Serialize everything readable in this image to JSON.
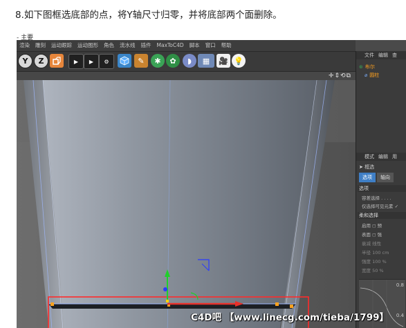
{
  "instruction": "8.如下图框选底部的点，将Y轴尺寸归零，并将底部两个面删除。",
  "caption": "- 主要",
  "menu": [
    "渲染",
    "雕刻",
    "运动跟踪",
    "运动图形",
    "角色",
    "流水线",
    "插件",
    "MaxToC4D",
    "脚本",
    "窗口",
    "帮助"
  ],
  "toolbar": {
    "y_lock": "Y",
    "z_lock": "Z",
    "world_icon": "coordinate-system-icon",
    "render_icons": [
      "render-view-icon",
      "render-picture-viewer-icon",
      "render-settings-icon"
    ],
    "object_icons": [
      "cube-icon",
      "pen-spline-icon",
      "subdivision-icon",
      "array-icon",
      "deformer-icon",
      "floor-icon",
      "camera-icon",
      "light-icon"
    ]
  },
  "viewport": {
    "nav_icons": "✛⇕⟲⧉",
    "selection_color": "#ff3333",
    "axis_y_color": "#1fd02a",
    "axis_x_color": "#e8302a",
    "axis_z_color": "#2a3bff",
    "point_color": "#ffa21e"
  },
  "right_panel": {
    "obj_tabs": [
      "文件",
      "编辑",
      "查"
    ],
    "objects": [
      {
        "name": "布尔",
        "icon": "boolean-icon"
      },
      {
        "name": "圆柱",
        "icon": "cylinder-icon"
      }
    ],
    "attr_tabs": [
      "模式",
      "编辑",
      "用"
    ],
    "mode": "框选",
    "seg_tabs": [
      "选项",
      "轴向"
    ],
    "section_select": "选项",
    "props_select": [
      "容差选择 . . . .",
      "仅选择可见元素 ✓"
    ],
    "section_soft": "柔和选择",
    "props_soft": [
      "启用 ◻   预",
      "表面 ◻   强",
      "衰减  线性",
      "半径  100 cm",
      "强度  100 %",
      "宽度  50 %"
    ],
    "graph_labels": [
      "0.8",
      "0.4"
    ]
  },
  "watermark": "C4D吧 【www.linecg.com/tieba/1799】"
}
